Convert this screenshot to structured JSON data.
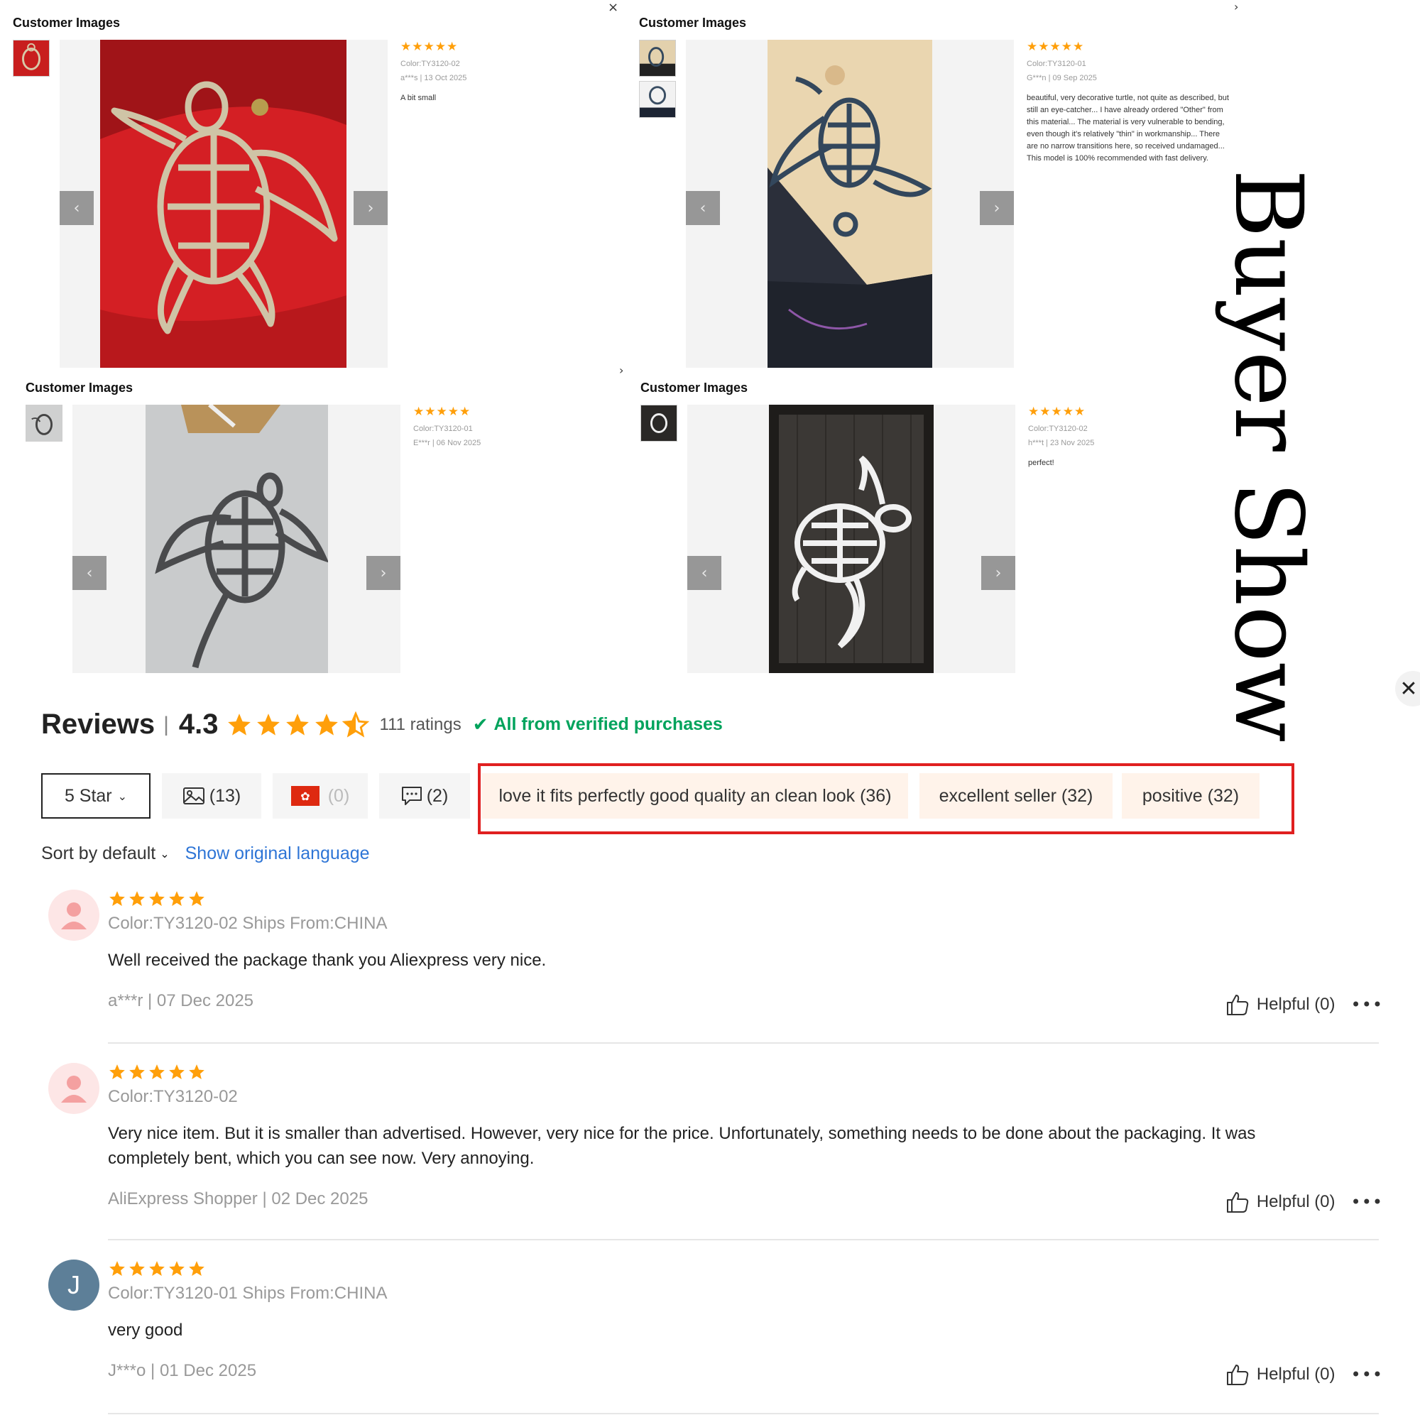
{
  "panels": [
    {
      "title": "Customer Images",
      "stars": "★★★★★",
      "color": "Color:TY3120-02",
      "meta": "a***s | 13 Oct 2025",
      "text": "A bit small"
    },
    {
      "title": "Customer Images",
      "stars": "★★★★★",
      "color": "Color:TY3120-01",
      "meta": "G***n | 09 Sep 2025",
      "text": "beautiful, very decorative turtle, not quite as described, but still an eye-catcher... I have already ordered \"Other\" from this material... The material is very vulnerable to bending, even though it's relatively \"thin\" in workmanship... There are no narrow transitions here, so received undamaged... This model is 100% recommended with fast delivery."
    },
    {
      "title": "Customer Images",
      "stars": "★★★★★",
      "color": "Color:TY3120-01",
      "meta": "E***r | 06 Nov 2025",
      "text": ""
    },
    {
      "title": "Customer Images",
      "stars": "★★★★★",
      "color": "Color:TY3120-02",
      "meta": "h***t | 23 Nov 2025",
      "text": "perfect!"
    }
  ],
  "icons": {
    "close": "×",
    "prev": "‹",
    "next": "›",
    "more": "•••"
  },
  "watermark": "Buyer Show",
  "reviews_header": {
    "title": "Reviews",
    "separator": "|",
    "score": "4.3",
    "ratings": "111 ratings",
    "verified": "All from verified purchases"
  },
  "filters": {
    "star_filter": "5 Star",
    "images_count": "(13)",
    "country_count": "(0)",
    "comments_count": "(2)"
  },
  "tags": [
    "love it fits perfectly good quality an clean look (36)",
    "excellent seller (32)",
    "positive (32)"
  ],
  "sort": {
    "label": "Sort by default",
    "show_original": "Show original language"
  },
  "reviews": [
    {
      "sku": "Color:TY3120-02 Ships From:CHINA",
      "text": "Well received the package thank you Aliexpress very nice.",
      "meta": "a***r | 07 Dec 2025",
      "helpful": "Helpful (0)"
    },
    {
      "sku": "Color:TY3120-02",
      "text": "Very nice item. But it is smaller than advertised. However, very nice for the price. Unfortunately, something needs to be done about the packaging. It was completely bent, which you can see now. Very annoying.",
      "meta": "AliExpress Shopper | 02 Dec 2025",
      "helpful": "Helpful (0)"
    },
    {
      "avatar_letter": "J",
      "sku": "Color:TY3120-01 Ships From:CHINA",
      "text": "very good",
      "meta": "J***o | 01 Dec 2025",
      "helpful": "Helpful (0)"
    }
  ],
  "colors": {
    "star": "#ff9f0a",
    "verified": "#00a35c",
    "link": "#2e75d6",
    "tag_bg": "#fff3ea",
    "highlight_border": "#e02020"
  }
}
